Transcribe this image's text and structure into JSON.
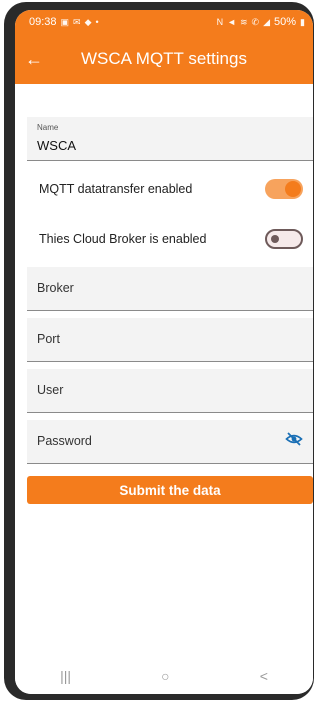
{
  "status_bar": {
    "time": "09:38",
    "battery": "50%",
    "left_icons": [
      "gallery-icon",
      "email-icon",
      "app-icon",
      "dot-icon"
    ],
    "right_icons": [
      "nfc-icon",
      "mute-icon",
      "wifi-icon",
      "call-icon",
      "signal-icon",
      "battery-icon"
    ]
  },
  "app_bar": {
    "title": "WSCA MQTT settings",
    "back_icon": "arrow-back-icon"
  },
  "form": {
    "name": {
      "label": "Name",
      "value": "WSCA"
    },
    "mqtt_toggle": {
      "label": "MQTT datatransfer enabled",
      "state": "on"
    },
    "cloud_toggle": {
      "label": "Thies Cloud Broker is enabled",
      "state": "off"
    },
    "broker": {
      "placeholder": "Broker"
    },
    "port": {
      "placeholder": "Port"
    },
    "user": {
      "placeholder": "User"
    },
    "password": {
      "placeholder": "Password",
      "icon": "visibility-off-icon"
    },
    "submit_label": "Submit the data"
  },
  "nav_bar": {
    "recent_label": "|||",
    "home_label": "○",
    "back_label": "<"
  },
  "colors": {
    "accent": "#f47c1c",
    "toggle_on_track": "#f7a35d",
    "field_bg": "#f3f3f3"
  }
}
